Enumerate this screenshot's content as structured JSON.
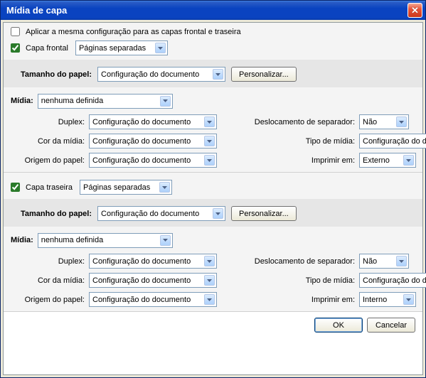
{
  "title": "Mídia de capa",
  "checkbox_same": "Aplicar a mesma configuração para as capas frontal e traseira",
  "front": {
    "cover_label": "Capa frontal",
    "cover_mode": "Páginas separadas",
    "paper_size_lbl": "Tamanho do papel:",
    "paper_size_val": "Configuração do documento",
    "customize_btn": "Personalizar...",
    "media_lbl": "Mídia:",
    "media_val": "nenhuma definida",
    "duplex_lbl": "Duplex:",
    "duplex_val": "Configuração do documento",
    "sep_offset_lbl": "Deslocamento de separador:",
    "sep_offset_val": "Não",
    "media_color_lbl": "Cor da mídia:",
    "media_color_val": "Configuração do documento",
    "media_type_lbl": "Tipo de mídia:",
    "media_type_val": "Configuração do documento",
    "paper_src_lbl": "Origem do papel:",
    "paper_src_val": "Configuração do documento",
    "print_on_lbl": "Imprimir em:",
    "print_on_val": "Externo"
  },
  "back": {
    "cover_label": "Capa traseira",
    "cover_mode": "Páginas separadas",
    "paper_size_lbl": "Tamanho do papel:",
    "paper_size_val": "Configuração do documento",
    "customize_btn": "Personalizar...",
    "media_lbl": "Mídia:",
    "media_val": "nenhuma definida",
    "duplex_lbl": "Duplex:",
    "duplex_val": "Configuração do documento",
    "sep_offset_lbl": "Deslocamento de separador:",
    "sep_offset_val": "Não",
    "media_color_lbl": "Cor da mídia:",
    "media_color_val": "Configuração do documento",
    "media_type_lbl": "Tipo de mídia:",
    "media_type_val": "Configuração do documento",
    "paper_src_lbl": "Origem do papel:",
    "paper_src_val": "Configuração do documento",
    "print_on_lbl": "Imprimir em:",
    "print_on_val": "Interno"
  },
  "buttons": {
    "ok": "OK",
    "cancel": "Cancelar"
  }
}
